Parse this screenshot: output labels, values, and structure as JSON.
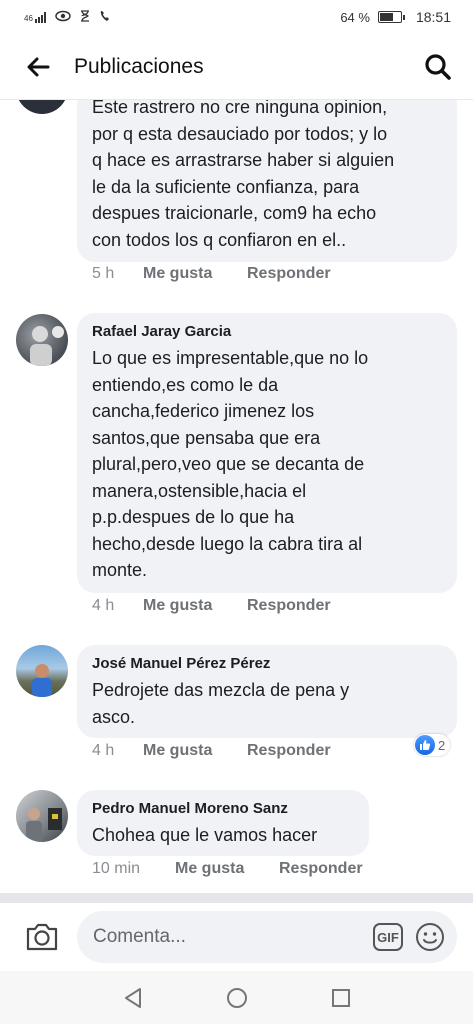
{
  "status_bar": {
    "network": "46",
    "battery_pct": "64 %",
    "battery_level": 0.64,
    "time": "18:51"
  },
  "header": {
    "title": "Publicaciones",
    "back_icon": "arrow-left-icon",
    "search_icon": "search-icon"
  },
  "comments": [
    {
      "author": "",
      "text": "Este rastrero no cre ninguna opinion,\npor q esta desauciado por todos; y lo\nq hace es arrastrarse haber si alguien\nle da la suficiente confianza, para\ndespues traicionarle, com9 ha echo\ncon todos los q confiaron en el..",
      "time": "5 h",
      "like": "Me gusta",
      "reply": "Responder"
    },
    {
      "author": "Rafael Jaray Garcia",
      "text": "Lo que es impresentable,que no lo\nentiendo,es como le da\ncancha,federico jimenez los\nsantos,que pensaba que era\nplural,pero,veo que se decanta de\nmanera,ostensible,hacia el\np.p.despues de lo que ha\nhecho,desde luego la cabra tira al\nmonte.",
      "time": "4 h",
      "like": "Me gusta",
      "reply": "Responder"
    },
    {
      "author": "José Manuel Pérez Pérez",
      "text": "Pedrojete das mezcla de pena y\nasco.",
      "time": "4 h",
      "like": "Me gusta",
      "reply": "Responder",
      "reaction_count": "2"
    },
    {
      "author": "Pedro Manuel Moreno Sanz",
      "text": "Chohea que le vamos hacer",
      "time": "10 min",
      "like": "Me gusta",
      "reply": "Responder"
    }
  ],
  "composer": {
    "placeholder": "Comenta...",
    "gif_label": "GIF",
    "camera_icon": "camera-icon",
    "emoji_icon": "emoji-icon"
  },
  "navbar": {
    "back": "nav-back-icon",
    "home": "nav-home-icon",
    "recents": "nav-recents-icon"
  },
  "colors": {
    "bubble": "#f0f2f5",
    "like_blue": "#1877f2",
    "secondary_text": "#65676b"
  }
}
